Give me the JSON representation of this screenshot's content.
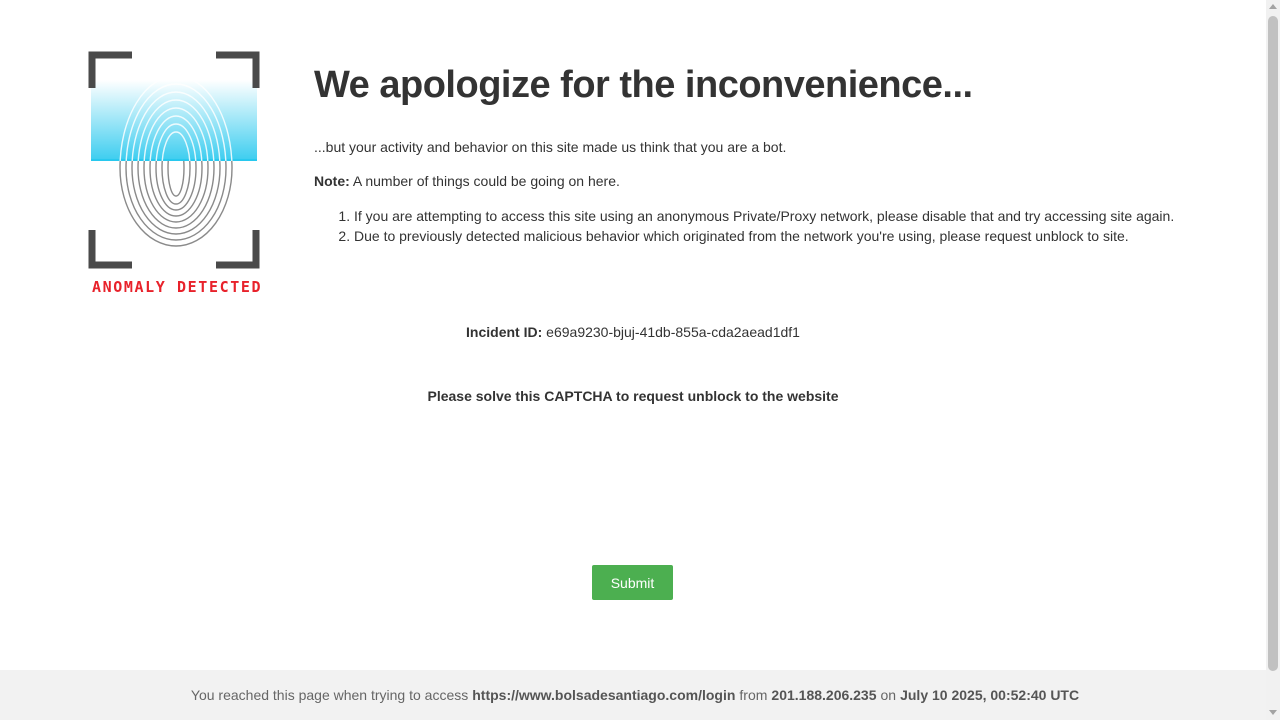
{
  "logo": {
    "caption": "ANOMALY DETECTED",
    "caption_color": "#e8222b",
    "scan_color": "#28c8ee",
    "icon": "fingerprint-icon"
  },
  "heading": "We apologize for the inconvenience...",
  "intro": "...but your activity and behavior on this site made us think that you are a bot.",
  "note": {
    "label": "Note:",
    "text": "A number of things could be going on here."
  },
  "reasons": [
    "If you are attempting to access this site using an anonymous Private/Proxy network, please disable that and try accessing site again.",
    "Due to previously detected malicious behavior which originated from the network you're using, please request unblock to site."
  ],
  "incident": {
    "label": "Incident ID:",
    "value": "e69a9230-bjuj-41db-855a-cda2aead1df1"
  },
  "captcha_prompt": "Please solve this CAPTCHA to request unblock to the website",
  "submit_label": "Submit",
  "submit_color": "#4caf50",
  "footer": {
    "prefix": "You reached this page when trying to access",
    "url": "https://www.bolsadesantiago.com/login",
    "from_word": "from",
    "ip": "201.188.206.235",
    "on_word": "on",
    "datetime": "July 10 2025, 00:52:40 UTC"
  }
}
